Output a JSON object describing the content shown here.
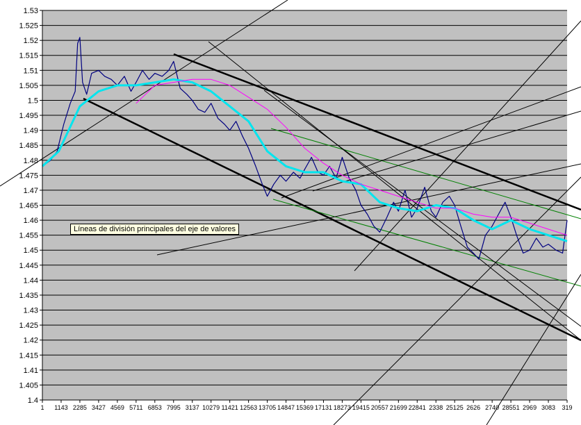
{
  "chart_data": {
    "type": "line",
    "title": "",
    "xlabel": "",
    "ylabel": "",
    "ylim": [
      1.4,
      1.53
    ],
    "y_ticks": [
      "1.53",
      "1.525",
      "1.52",
      "1.515",
      "1.51",
      "1.505",
      "1.5",
      "1.495",
      "1.49",
      "1.485",
      "1.48",
      "1.475",
      "1.47",
      "1.465",
      "1.46",
      "1.455",
      "1.45",
      "1.445",
      "1.44",
      "1.435",
      "1.43",
      "1.425",
      "1.42",
      "1.415",
      "1.41",
      "1.405",
      "1.4"
    ],
    "x_ticks": [
      "1",
      "1143",
      "2285",
      "3427",
      "4569",
      "5711",
      "6853",
      "7995",
      "9137",
      "10279",
      "11421",
      "12563",
      "13705",
      "14847",
      "15989",
      "17131",
      "18273",
      "19415",
      "20557",
      "21699",
      "22841",
      "23983",
      "25125",
      "26267",
      "27409",
      "28551",
      "29693",
      "30835",
      "31977"
    ],
    "x_tick_labels": [
      "1",
      "1143",
      "2285",
      "3427",
      "4569",
      "5711",
      "6853",
      "7995",
      "3137",
      "10279",
      "11421",
      "12563",
      "13705",
      "14847",
      "15369",
      "17131",
      "18273",
      "19415",
      "20557",
      "21699",
      "22841",
      "2338",
      "25125",
      "2626",
      "2740",
      "28551",
      "2969",
      "3083",
      "319"
    ],
    "grid": true,
    "plot_background": "#c0c0c0",
    "tooltip": "Líneas de división principales del eje de valores",
    "series": [
      {
        "color": "#000080",
        "x": [
          1,
          500,
          900,
          1300,
          1700,
          2000,
          2150,
          2285,
          2450,
          2700,
          3000,
          3427,
          3800,
          4200,
          4569,
          5000,
          5400,
          5711,
          6100,
          6500,
          6853,
          7300,
          7700,
          7995,
          8400,
          8800,
          9137,
          9500,
          9900,
          10279,
          10700,
          11100,
          11421,
          11800,
          12200,
          12563,
          13000,
          13400,
          13705,
          14100,
          14500,
          14847,
          15300,
          15700,
          15989,
          16400,
          16800,
          17131,
          17500,
          17900,
          18273,
          18700,
          19100,
          19415,
          19800,
          20200,
          20557,
          21000,
          21400,
          21699,
          22100,
          22500,
          22841,
          23300,
          23700,
          23983,
          24400,
          24800,
          25125,
          25500,
          25900,
          26267,
          26600,
          27000,
          27409,
          27800,
          28200,
          28551,
          28900,
          29300,
          29693,
          30100,
          30500,
          30835,
          31300,
          31700,
          31977
        ],
        "values": [
          1.478,
          1.48,
          1.483,
          1.492,
          1.499,
          1.503,
          1.519,
          1.521,
          1.506,
          1.502,
          1.509,
          1.51,
          1.508,
          1.507,
          1.505,
          1.508,
          1.503,
          1.506,
          1.51,
          1.507,
          1.509,
          1.508,
          1.51,
          1.513,
          1.504,
          1.502,
          1.5,
          1.497,
          1.496,
          1.499,
          1.494,
          1.492,
          1.49,
          1.493,
          1.488,
          1.484,
          1.478,
          1.472,
          1.468,
          1.472,
          1.475,
          1.473,
          1.476,
          1.474,
          1.477,
          1.481,
          1.476,
          1.475,
          1.478,
          1.474,
          1.481,
          1.474,
          1.47,
          1.465,
          1.462,
          1.458,
          1.456,
          1.461,
          1.466,
          1.463,
          1.47,
          1.461,
          1.464,
          1.471,
          1.463,
          1.461,
          1.466,
          1.468,
          1.465,
          1.458,
          1.451,
          1.449,
          1.447,
          1.455,
          1.458,
          1.462,
          1.466,
          1.461,
          1.455,
          1.449,
          1.45,
          1.454,
          1.451,
          1.452,
          1.45,
          1.449,
          1.46
        ]
      },
      {
        "color": "#00e5ee",
        "x": [
          1,
          1000,
          2285,
          3427,
          4569,
          5711,
          6853,
          7995,
          9137,
          10279,
          11421,
          12563,
          13705,
          14847,
          15989,
          17131,
          18273,
          19415,
          20557,
          21699,
          22841,
          23983,
          25125,
          26267,
          27409,
          28551,
          29693,
          30835,
          31977
        ],
        "values": [
          1.478,
          1.483,
          1.498,
          1.503,
          1.505,
          1.505,
          1.506,
          1.507,
          1.506,
          1.503,
          1.498,
          1.493,
          1.483,
          1.478,
          1.476,
          1.476,
          1.473,
          1.472,
          1.466,
          1.464,
          1.463,
          1.465,
          1.464,
          1.46,
          1.457,
          1.46,
          1.457,
          1.455,
          1.453
        ]
      },
      {
        "color": "#ff00ff",
        "x": [
          5711,
          6853,
          7995,
          9137,
          10279,
          11421,
          12563,
          13705,
          14847,
          15989,
          17131,
          18273,
          19415,
          20557,
          21699,
          22841,
          23983,
          25125,
          26267,
          27409,
          28551,
          29693,
          30835,
          31977
        ],
        "values": [
          1.499,
          1.505,
          1.506,
          1.507,
          1.507,
          1.505,
          1.501,
          1.497,
          1.491,
          1.484,
          1.479,
          1.475,
          1.472,
          1.47,
          1.468,
          1.466,
          1.464,
          1.464,
          1.462,
          1.461,
          1.461,
          1.459,
          1.457,
          1.455
        ]
      }
    ]
  }
}
